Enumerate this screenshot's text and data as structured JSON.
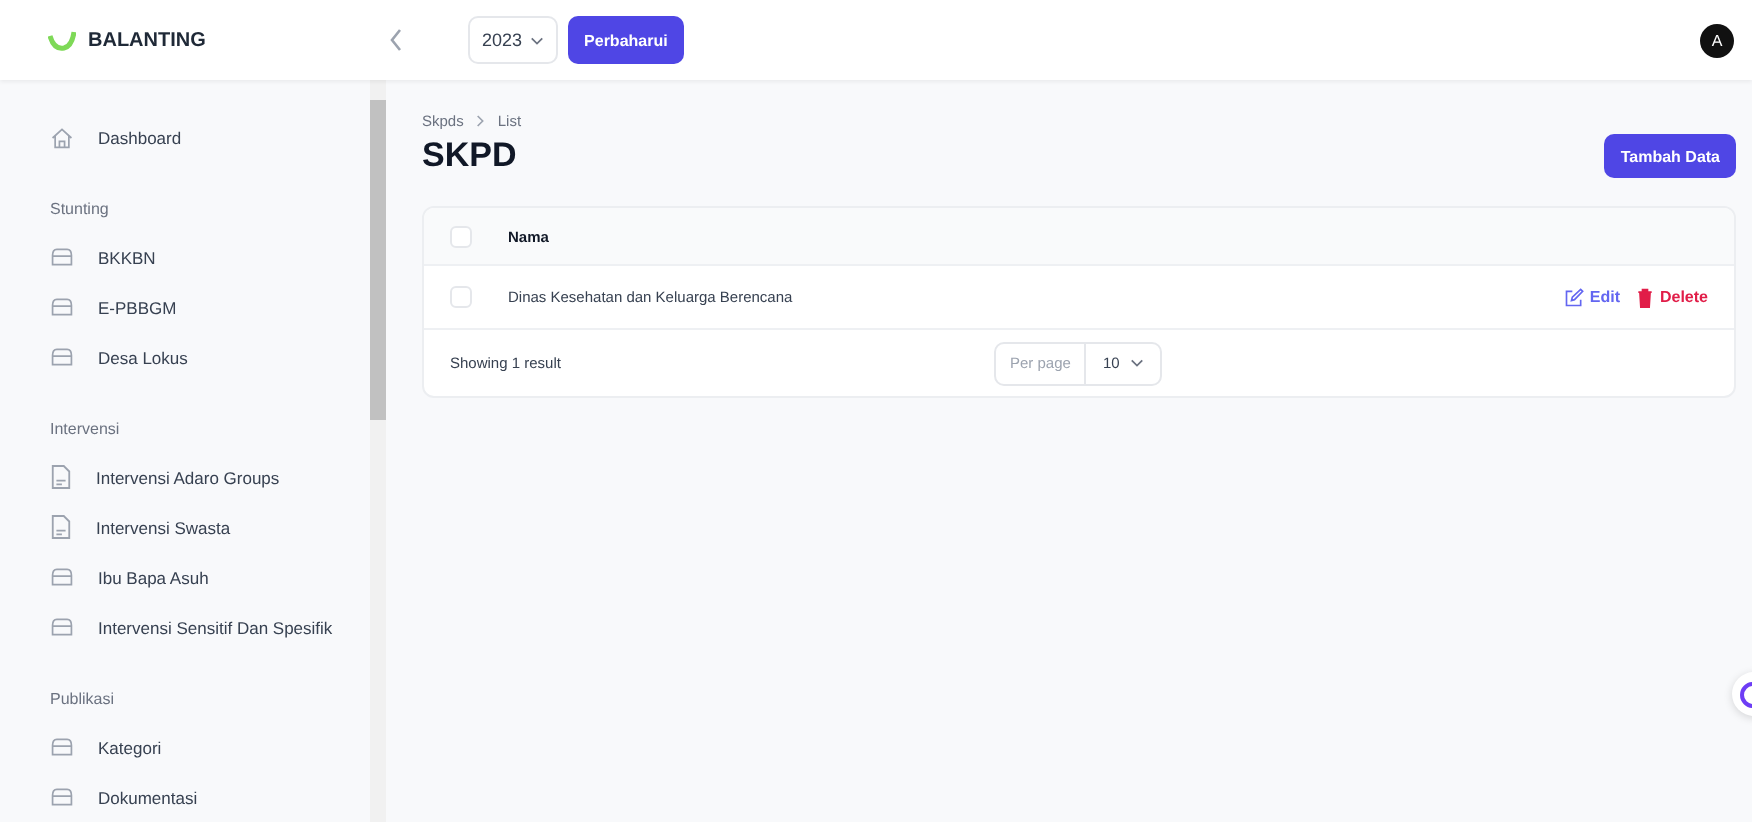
{
  "app": {
    "name": "BALANTING"
  },
  "topbar": {
    "year": "2023",
    "refresh_button": "Perbaharui",
    "avatar": "A"
  },
  "sidebar": {
    "items": [
      {
        "label": "Dashboard",
        "kind": "home"
      }
    ],
    "groups": [
      {
        "title": "Stunting",
        "items": [
          {
            "label": "BKKBN",
            "kind": "folder"
          },
          {
            "label": "E-PBBGM",
            "kind": "folder"
          },
          {
            "label": "Desa Lokus",
            "kind": "folder"
          }
        ]
      },
      {
        "title": "Intervensi",
        "items": [
          {
            "label": "Intervensi Adaro Groups",
            "kind": "doc"
          },
          {
            "label": "Intervensi Swasta",
            "kind": "doc"
          },
          {
            "label": "Ibu Bapa Asuh",
            "kind": "folder"
          },
          {
            "label": "Intervensi Sensitif Dan Spesifik",
            "kind": "folder"
          }
        ]
      },
      {
        "title": "Publikasi",
        "items": [
          {
            "label": "Kategori",
            "kind": "folder"
          },
          {
            "label": "Dokumentasi",
            "kind": "folder"
          }
        ]
      }
    ]
  },
  "breadcrumb": [
    "Skpds",
    "List"
  ],
  "page_title": "SKPD",
  "add_button": "Tambah Data",
  "table": {
    "columns": [
      "Nama"
    ],
    "header_checked": false,
    "rows": [
      {
        "nama": "Dinas Kesehatan dan Keluarga Berencana",
        "checked": false,
        "actions": [
          {
            "label": "Edit",
            "kind": "edit"
          },
          {
            "label": "Delete",
            "kind": "delete"
          }
        ]
      }
    ],
    "footer": {
      "summary": "Showing 1 result",
      "per_page_label": "Per page",
      "per_page": "10"
    }
  }
}
